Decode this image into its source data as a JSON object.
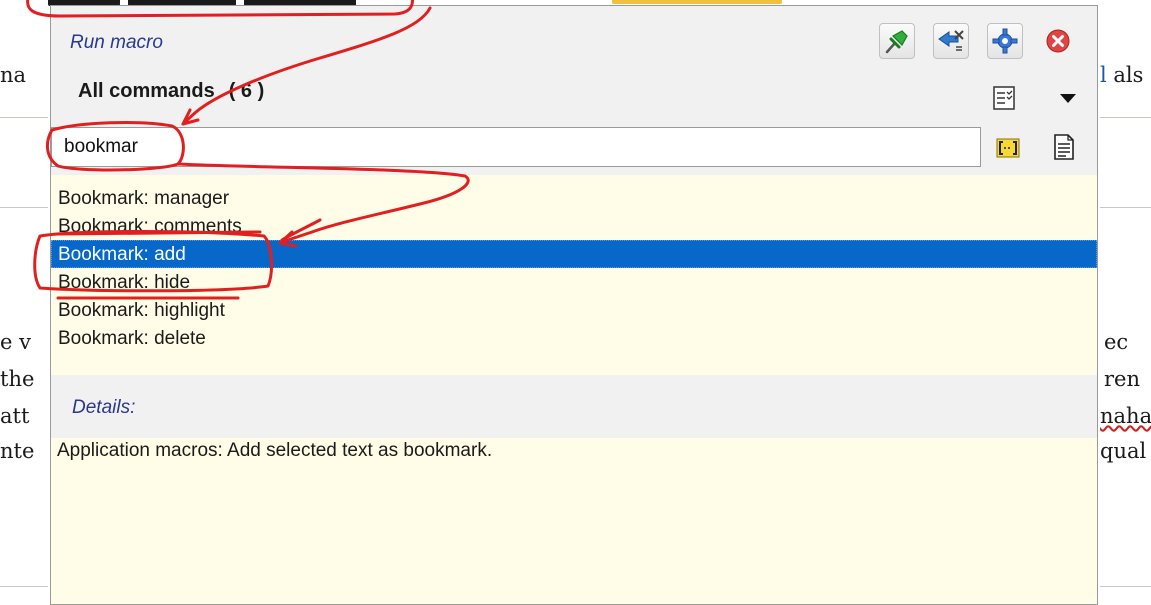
{
  "popup": {
    "title": "Run macro",
    "heading": "All commands",
    "count": "( 6 )",
    "search": {
      "value": "bookmar",
      "placeholder": ""
    },
    "commands": [
      {
        "label": "Bookmark: manager",
        "selected": false
      },
      {
        "label": "Bookmark: comments",
        "selected": false
      },
      {
        "label": "Bookmark: add",
        "selected": true
      },
      {
        "label": "Bookmark: hide",
        "selected": false
      },
      {
        "label": "Bookmark: highlight",
        "selected": false
      },
      {
        "label": "Bookmark: delete",
        "selected": false
      }
    ],
    "details_label": "Details:",
    "details_text": "Application macros: Add selected text as bookmark.",
    "toolbar_icons": [
      "pin-icon",
      "swap-icon",
      "gear-icon",
      "close-icon",
      "list-view-icon",
      "dropdown-arrow-icon",
      "bracket-icon",
      "document-icon"
    ]
  },
  "background": {
    "fragments_left": [
      "na",
      "e v",
      "the",
      "att",
      "nte"
    ],
    "fragments_right": [
      "l als",
      "ec",
      "ren",
      "naha",
      "qual"
    ]
  },
  "colors": {
    "selection": "#0868c9",
    "list_bg": "#fffde8",
    "header_bg": "#f1f1f1",
    "title_blue": "#2a3890",
    "annotation_red": "#e02020"
  }
}
